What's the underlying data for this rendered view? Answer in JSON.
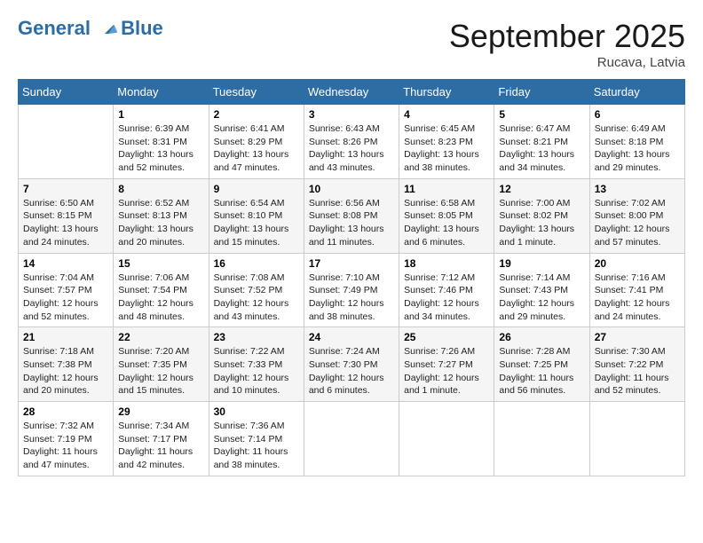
{
  "header": {
    "logo_line1": "General",
    "logo_line2": "Blue",
    "month_title": "September 2025",
    "location": "Rucava, Latvia"
  },
  "weekdays": [
    "Sunday",
    "Monday",
    "Tuesday",
    "Wednesday",
    "Thursday",
    "Friday",
    "Saturday"
  ],
  "weeks": [
    [
      {
        "day": "",
        "info": ""
      },
      {
        "day": "1",
        "info": "Sunrise: 6:39 AM\nSunset: 8:31 PM\nDaylight: 13 hours\nand 52 minutes."
      },
      {
        "day": "2",
        "info": "Sunrise: 6:41 AM\nSunset: 8:29 PM\nDaylight: 13 hours\nand 47 minutes."
      },
      {
        "day": "3",
        "info": "Sunrise: 6:43 AM\nSunset: 8:26 PM\nDaylight: 13 hours\nand 43 minutes."
      },
      {
        "day": "4",
        "info": "Sunrise: 6:45 AM\nSunset: 8:23 PM\nDaylight: 13 hours\nand 38 minutes."
      },
      {
        "day": "5",
        "info": "Sunrise: 6:47 AM\nSunset: 8:21 PM\nDaylight: 13 hours\nand 34 minutes."
      },
      {
        "day": "6",
        "info": "Sunrise: 6:49 AM\nSunset: 8:18 PM\nDaylight: 13 hours\nand 29 minutes."
      }
    ],
    [
      {
        "day": "7",
        "info": "Sunrise: 6:50 AM\nSunset: 8:15 PM\nDaylight: 13 hours\nand 24 minutes."
      },
      {
        "day": "8",
        "info": "Sunrise: 6:52 AM\nSunset: 8:13 PM\nDaylight: 13 hours\nand 20 minutes."
      },
      {
        "day": "9",
        "info": "Sunrise: 6:54 AM\nSunset: 8:10 PM\nDaylight: 13 hours\nand 15 minutes."
      },
      {
        "day": "10",
        "info": "Sunrise: 6:56 AM\nSunset: 8:08 PM\nDaylight: 13 hours\nand 11 minutes."
      },
      {
        "day": "11",
        "info": "Sunrise: 6:58 AM\nSunset: 8:05 PM\nDaylight: 13 hours\nand 6 minutes."
      },
      {
        "day": "12",
        "info": "Sunrise: 7:00 AM\nSunset: 8:02 PM\nDaylight: 13 hours\nand 1 minute."
      },
      {
        "day": "13",
        "info": "Sunrise: 7:02 AM\nSunset: 8:00 PM\nDaylight: 12 hours\nand 57 minutes."
      }
    ],
    [
      {
        "day": "14",
        "info": "Sunrise: 7:04 AM\nSunset: 7:57 PM\nDaylight: 12 hours\nand 52 minutes."
      },
      {
        "day": "15",
        "info": "Sunrise: 7:06 AM\nSunset: 7:54 PM\nDaylight: 12 hours\nand 48 minutes."
      },
      {
        "day": "16",
        "info": "Sunrise: 7:08 AM\nSunset: 7:52 PM\nDaylight: 12 hours\nand 43 minutes."
      },
      {
        "day": "17",
        "info": "Sunrise: 7:10 AM\nSunset: 7:49 PM\nDaylight: 12 hours\nand 38 minutes."
      },
      {
        "day": "18",
        "info": "Sunrise: 7:12 AM\nSunset: 7:46 PM\nDaylight: 12 hours\nand 34 minutes."
      },
      {
        "day": "19",
        "info": "Sunrise: 7:14 AM\nSunset: 7:43 PM\nDaylight: 12 hours\nand 29 minutes."
      },
      {
        "day": "20",
        "info": "Sunrise: 7:16 AM\nSunset: 7:41 PM\nDaylight: 12 hours\nand 24 minutes."
      }
    ],
    [
      {
        "day": "21",
        "info": "Sunrise: 7:18 AM\nSunset: 7:38 PM\nDaylight: 12 hours\nand 20 minutes."
      },
      {
        "day": "22",
        "info": "Sunrise: 7:20 AM\nSunset: 7:35 PM\nDaylight: 12 hours\nand 15 minutes."
      },
      {
        "day": "23",
        "info": "Sunrise: 7:22 AM\nSunset: 7:33 PM\nDaylight: 12 hours\nand 10 minutes."
      },
      {
        "day": "24",
        "info": "Sunrise: 7:24 AM\nSunset: 7:30 PM\nDaylight: 12 hours\nand 6 minutes."
      },
      {
        "day": "25",
        "info": "Sunrise: 7:26 AM\nSunset: 7:27 PM\nDaylight: 12 hours\nand 1 minute."
      },
      {
        "day": "26",
        "info": "Sunrise: 7:28 AM\nSunset: 7:25 PM\nDaylight: 11 hours\nand 56 minutes."
      },
      {
        "day": "27",
        "info": "Sunrise: 7:30 AM\nSunset: 7:22 PM\nDaylight: 11 hours\nand 52 minutes."
      }
    ],
    [
      {
        "day": "28",
        "info": "Sunrise: 7:32 AM\nSunset: 7:19 PM\nDaylight: 11 hours\nand 47 minutes."
      },
      {
        "day": "29",
        "info": "Sunrise: 7:34 AM\nSunset: 7:17 PM\nDaylight: 11 hours\nand 42 minutes."
      },
      {
        "day": "30",
        "info": "Sunrise: 7:36 AM\nSunset: 7:14 PM\nDaylight: 11 hours\nand 38 minutes."
      },
      {
        "day": "",
        "info": ""
      },
      {
        "day": "",
        "info": ""
      },
      {
        "day": "",
        "info": ""
      },
      {
        "day": "",
        "info": ""
      }
    ]
  ]
}
